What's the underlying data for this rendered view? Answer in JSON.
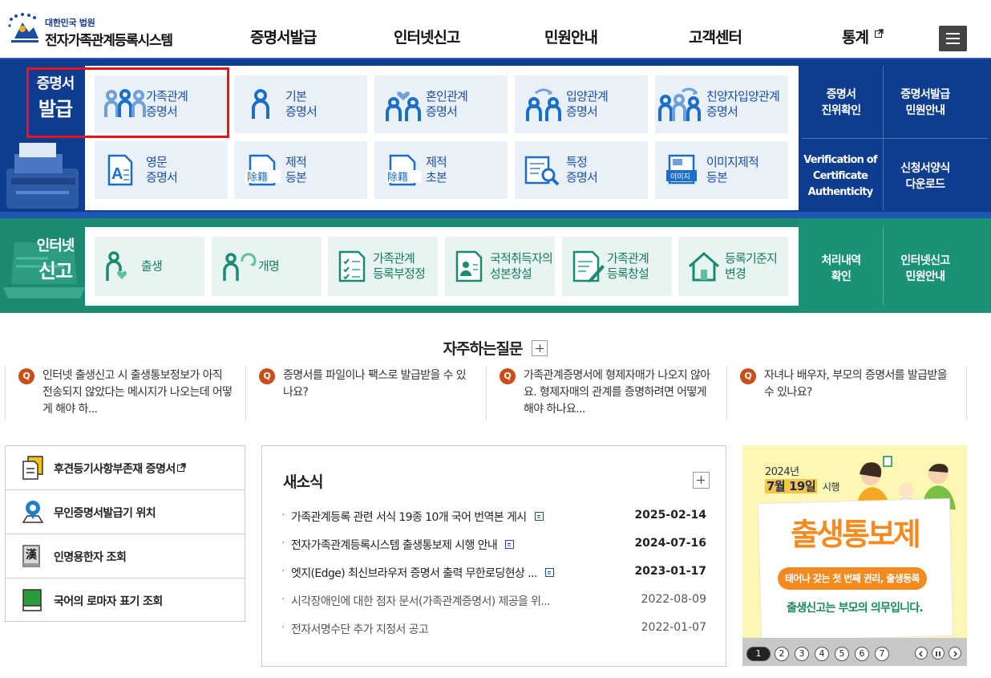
{
  "header": {
    "org": "대한민국 법원",
    "site_title": "전자가족관계등록시스템",
    "nav": [
      {
        "label": "증명서발급"
      },
      {
        "label": "인터넷신고"
      },
      {
        "label": "민원안내"
      },
      {
        "label": "고객센터"
      },
      {
        "label": "통계",
        "external": true
      }
    ],
    "menu_icon": "hamburger-icon"
  },
  "issue": {
    "label1": "증명서",
    "label2": "발급",
    "tiles": [
      {
        "label": "가족관계\n증명서",
        "icon": "family-icon"
      },
      {
        "label": "기본\n증명서",
        "icon": "person-icon"
      },
      {
        "label": "혼인관계\n증명서",
        "icon": "couple-heart-icon"
      },
      {
        "label": "입양관계\n증명서",
        "icon": "adoption-icon"
      },
      {
        "label": "친양자입양관계\n증명서",
        "icon": "family-adoption-icon"
      },
      {
        "label": "영문\n증명서",
        "icon": "english-doc-icon"
      },
      {
        "label": "제적\n등본",
        "icon": "removed-register-doc-icon"
      },
      {
        "label": "제적\n초본",
        "icon": "removed-register-doc-icon"
      },
      {
        "label": "특정\n증명서",
        "icon": "doc-search-icon"
      },
      {
        "label": "이미지제적\n등본",
        "icon": "image-register-icon"
      }
    ],
    "side": [
      {
        "label": "증명서\n진위확인"
      },
      {
        "label": "증명서발급\n민원안내"
      },
      {
        "label": "Verification of\nCertificate\nAuthenticity"
      },
      {
        "label": "신청서양식\n다운로드"
      }
    ],
    "doc_icon_text": "除籍",
    "image_icon_text": "이미지",
    "highlight_color": "#e8141b"
  },
  "report": {
    "label1": "인터넷",
    "label2": "신고",
    "tiles": [
      {
        "label": "출생",
        "icon": "birth-icon"
      },
      {
        "label": "개명",
        "icon": "rename-icon"
      },
      {
        "label": "가족관계\n등록부정정",
        "icon": "checklist-doc-icon"
      },
      {
        "label": "국적취득자의\n성본창설",
        "icon": "id-card-icon"
      },
      {
        "label": "가족관계\n등록창설",
        "icon": "doc-pen-icon"
      },
      {
        "label": "등록기준지\n변경",
        "icon": "house-icon"
      }
    ],
    "side": [
      {
        "label": "처리내역\n확인"
      },
      {
        "label": "인터넷신고\n민원안내"
      }
    ]
  },
  "faq": {
    "title": "자주하는질문",
    "badge": "Q",
    "items": [
      {
        "text": "인터넷 출생신고 시 출생통보정보가 아직 전송되지 않았다는 메시지가 나오는데 어떻게 해야 하..."
      },
      {
        "text": "증명서를 파일이나 팩스로 발급받을 수 있나요?"
      },
      {
        "text": "가족관계증명서에 형제자매가 나오지 않아요. 형제자매의 관계를 증명하려면 어떻게 해야 하나요..."
      },
      {
        "text": "자녀나 배우자, 부모의 증명서를 발급받을 수 있나요?"
      }
    ]
  },
  "quick": [
    {
      "label": "후견등기사항부존재 증명서",
      "icon": "document-icon",
      "external": true
    },
    {
      "label": "무인증명서발급기 위치",
      "icon": "location-pin-icon"
    },
    {
      "label": "인명용한자 조회",
      "icon": "hanja-book-icon",
      "glyph": "漢"
    },
    {
      "label": "국어의 로마자 표기 조회",
      "icon": "green-book-icon"
    }
  ],
  "news": {
    "title": "새소식",
    "items": [
      {
        "title": "가족관계등록 관련 서식 19종 10개 국어 번역본 게시",
        "date": "2025-02-14",
        "new": true
      },
      {
        "title": "전자가족관계등록시스템 출생통보제 시행 안내",
        "date": "2024-07-16",
        "new": true
      },
      {
        "title": "엣지(Edge) 최신브라우저 증명서 출력 무한로딩현상 ...",
        "date": "2023-01-17",
        "new": true
      },
      {
        "title": "시각장애인에 대한 점자 문서(가족관계증명서) 제공을 위...",
        "date": "2022-08-09",
        "new": false
      },
      {
        "title": "전자서명수단 추가 지정서 공고",
        "date": "2022-01-07",
        "new": false
      }
    ]
  },
  "banner": {
    "year": "2024년",
    "date": "7월 19일",
    "date_suffix": "시행",
    "main": "출생통보제",
    "pill": "태어나 갖는 첫 번째 권리, 출생등록",
    "footer": "출생신고는 부모의 의무입니다.",
    "pages": [
      "1",
      "2",
      "3",
      "4",
      "5",
      "6",
      "7"
    ],
    "active_page": "1"
  }
}
